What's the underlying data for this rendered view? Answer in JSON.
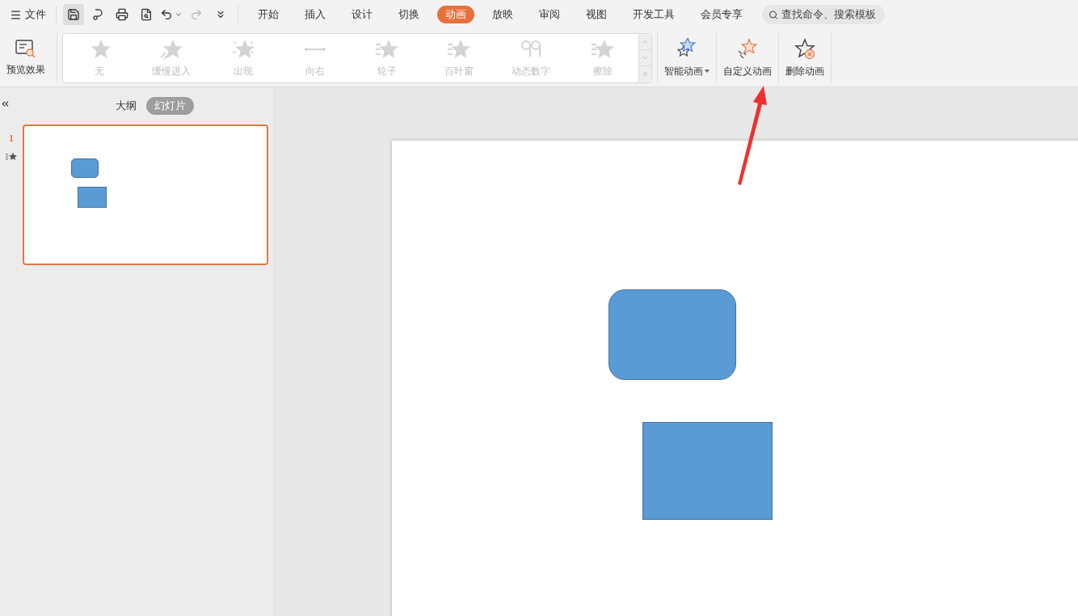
{
  "menu": {
    "file_label": "文件"
  },
  "tabs": [
    {
      "label": "开始",
      "selected": false
    },
    {
      "label": "插入",
      "selected": false
    },
    {
      "label": "设计",
      "selected": false
    },
    {
      "label": "切换",
      "selected": false
    },
    {
      "label": "动画",
      "selected": true
    },
    {
      "label": "放映",
      "selected": false
    },
    {
      "label": "审阅",
      "selected": false
    },
    {
      "label": "视图",
      "selected": false
    },
    {
      "label": "开发工具",
      "selected": false
    },
    {
      "label": "会员专享",
      "selected": false
    }
  ],
  "search": {
    "placeholder": "查找命令、搜索模板"
  },
  "ribbon": {
    "preview_label": "预览效果",
    "effects": [
      {
        "label": "无",
        "kind": "star",
        "disabled": true
      },
      {
        "label": "缓慢进入",
        "kind": "fly",
        "disabled": true
      },
      {
        "label": "出现",
        "kind": "burst",
        "disabled": true
      },
      {
        "label": "向右",
        "kind": "line",
        "disabled": true
      },
      {
        "label": "轮子",
        "kind": "wheel",
        "disabled": true
      },
      {
        "label": "百叶窗",
        "kind": "blinds",
        "disabled": true
      },
      {
        "label": "动态数字",
        "kind": "digits",
        "disabled": true
      },
      {
        "label": "擦除",
        "kind": "blinds",
        "disabled": true
      }
    ],
    "actions": [
      {
        "label": "智能动画",
        "kind": "smart",
        "dropdown": true
      },
      {
        "label": "自定义动画",
        "kind": "custom",
        "dropdown": false
      },
      {
        "label": "删除动画",
        "kind": "delete",
        "dropdown": false
      }
    ]
  },
  "panel": {
    "views": [
      {
        "label": "大纲",
        "selected": false
      },
      {
        "label": "幻灯片",
        "selected": true
      }
    ],
    "slides": [
      {
        "number": "1",
        "selected": true,
        "animated": true
      }
    ]
  }
}
